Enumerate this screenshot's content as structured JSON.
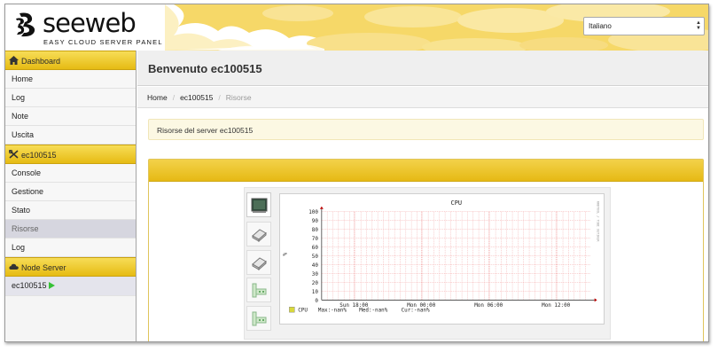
{
  "brand": {
    "name": "seeweb",
    "tagline": "EASY CLOUD SERVER PANEL"
  },
  "language": {
    "selected": "Italiano"
  },
  "sidebar": {
    "sections": [
      {
        "title": "Dashboard",
        "icon": "home-icon",
        "items": [
          "Home",
          "Log",
          "Note",
          "Uscita"
        ]
      },
      {
        "title": "ec100515",
        "icon": "tools-icon",
        "items": [
          "Console",
          "Gestione",
          "Stato",
          "Risorse",
          "Log"
        ],
        "active": "Risorse"
      },
      {
        "title": "Node Server",
        "icon": "cloud-icon",
        "items": [
          "ec100515"
        ]
      }
    ]
  },
  "main": {
    "title": "Benvenuto ec100515",
    "breadcrumb": [
      "Home",
      "ec100515",
      "Risorse"
    ],
    "alert": "Risorse del server ec100515"
  },
  "colors": {
    "accent": "#f0cc3a",
    "accent_dark": "#e6b914",
    "grid": "#f2a0a0",
    "active_item": "#d6d6df"
  },
  "graph": {
    "title": "CPU",
    "ylabel": "%",
    "right_label": "RRDTOOL / TOBI OETIKER",
    "legend": {
      "series": "CPU",
      "max": "Max:-nan%",
      "med": "Med:-nan%",
      "cur": "Cur:-nan%"
    }
  },
  "chart_data": {
    "type": "line",
    "title": "CPU",
    "ylabel": "%",
    "xlabel": "",
    "x_ticks": [
      "Sun 18:00",
      "Mon 00:00",
      "Mon 06:00",
      "Mon 12:00"
    ],
    "y_ticks": [
      0,
      10,
      20,
      30,
      40,
      50,
      60,
      70,
      80,
      90,
      100
    ],
    "ylim": [
      0,
      100
    ],
    "grid": true,
    "series": [
      {
        "name": "CPU",
        "values": []
      }
    ]
  }
}
